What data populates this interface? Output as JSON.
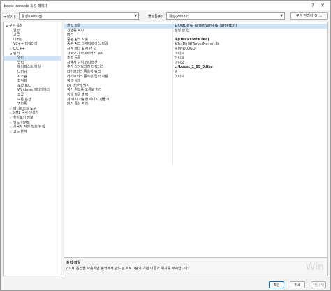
{
  "window": {
    "title": "boost_console 속성 페이지",
    "help": "?",
    "close": "✕"
  },
  "config": {
    "config_label": "구성(C):",
    "config_value": "활성(Debug)",
    "platform_label": "플랫폼(P):",
    "platform_value": "활성(Win32)",
    "manager_button": "구성 관리자(O)..."
  },
  "tree": [
    {
      "label": "구성 속성",
      "toggle": "◢"
    },
    {
      "label": "일반",
      "toggle": ""
    },
    {
      "label": "고급",
      "toggle": ""
    },
    {
      "label": "디버깅",
      "toggle": ""
    },
    {
      "label": "VC++ 디렉터리",
      "toggle": ""
    },
    {
      "label": "C/C++",
      "toggle": "▷"
    },
    {
      "label": "링커",
      "toggle": "◢"
    },
    {
      "label": "일반",
      "toggle": ""
    },
    {
      "label": "입력",
      "toggle": ""
    },
    {
      "label": "매니페스트 파일",
      "toggle": ""
    },
    {
      "label": "디버깅",
      "toggle": ""
    },
    {
      "label": "시스템",
      "toggle": ""
    },
    {
      "label": "최적화",
      "toggle": ""
    },
    {
      "label": "포함 IDL",
      "toggle": ""
    },
    {
      "label": "Windows 메타데이터",
      "toggle": ""
    },
    {
      "label": "고급",
      "toggle": ""
    },
    {
      "label": "모든 옵션",
      "toggle": ""
    },
    {
      "label": "명령줄",
      "toggle": ""
    },
    {
      "label": "매니페스트 도구",
      "toggle": "▷"
    },
    {
      "label": "XML 문서 생성기",
      "toggle": "▷"
    },
    {
      "label": "찾아보기 정보",
      "toggle": "▷"
    },
    {
      "label": "빌드 이벤트",
      "toggle": "▷"
    },
    {
      "label": "사용자 지정 빌드 단계",
      "toggle": "▷"
    },
    {
      "label": "코드 분석",
      "toggle": "▷"
    }
  ],
  "properties": [
    {
      "name": "출력 파일",
      "value": "$(OutDir)$(TargetName)$(TargetExt)"
    },
    {
      "name": "진행률 표시",
      "value": "설정 안 함"
    },
    {
      "name": "버전",
      "value": ""
    },
    {
      "name": "증분 링크 사용",
      "value": "예(/INCREMENTAL)"
    },
    {
      "name": "증분 링크 데이터베이스 파일",
      "value": "$(IntDir)$(TargetName).ilk"
    },
    {
      "name": "시작 배너 표시 안 함",
      "value": "예(/NOLOGO)"
    },
    {
      "name": "가져오기 라이브러리 무시",
      "value": "아니요"
    },
    {
      "name": "출력 등록",
      "value": "아니요"
    },
    {
      "name": "사용자 단위 리디렉션",
      "value": "아니요"
    },
    {
      "name": "추가 라이브러리 디렉터리",
      "value": "c:\\boost_1_85_0\\libs"
    },
    {
      "name": "라이브러리 종속성 링크",
      "value": "예"
    },
    {
      "name": "라이브러리 종속성 입력 사용",
      "value": "아니요"
    },
    {
      "name": "링크 상태",
      "value": ""
    },
    {
      "name": "Dll 바인딩 방지",
      "value": ""
    },
    {
      "name": "링커 경고를 오류로 처리",
      "value": ""
    },
    {
      "name": "강제 파일 출력",
      "value": ""
    },
    {
      "name": "핫 패치 가능한 이미지 만들기",
      "value": ""
    },
    {
      "name": "버전 특성 지정",
      "value": ""
    }
  ],
  "description": {
    "title": "출력 파일",
    "text": "/OUT 옵션을 사용하면 링커에서 만드는 프로그램의 기본 이름과 위치를 무시합니다."
  },
  "watermark": "Win",
  "buttons": {
    "ok": "확인",
    "cancel": "취소",
    "apply": "적용(A)"
  }
}
